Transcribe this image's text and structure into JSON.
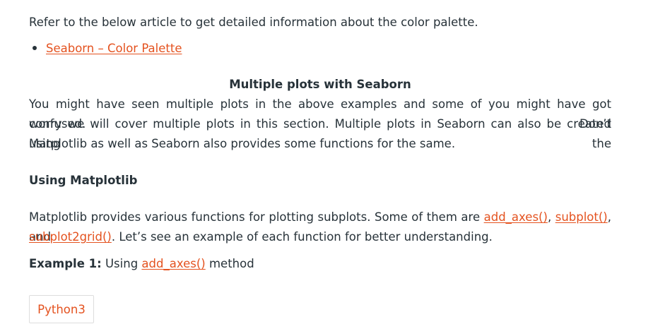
{
  "intro": {
    "text": "Refer to the below article to get detailed information about the color palette."
  },
  "links_list": [
    {
      "label": "Seaborn – Color Palette"
    }
  ],
  "section": {
    "title": "Multiple plots with Seaborn",
    "paragraph_lines": [
      "You might have seen multiple plots in the above examples and some of you might have got confused. Don’t",
      "worry we will cover multiple plots in this section. Multiple plots in Seaborn can also be created using the",
      "Matplotlib as well as Seaborn also provides some functions for the same."
    ]
  },
  "subsection": {
    "title": "Using Matplotlib",
    "line1_prefix": "Matplotlib provides various functions for plotting subplots. Some of them are ",
    "link_add_axes": "add_axes()",
    "sep1": ", ",
    "link_subplot": "subplot()",
    "sep2": ", and",
    "link_subplot2grid": "subplot2grid()",
    "line2_suffix": ". Let’s see an example of each function for better understanding."
  },
  "example": {
    "label": "Example 1:",
    "text_before": " Using ",
    "link": "add_axes()",
    "text_after": " method"
  },
  "code_tabs": [
    {
      "label": "Python3"
    }
  ],
  "colors": {
    "text": "#273239",
    "link": "#e4521f",
    "tab_border": "#dddddd"
  }
}
